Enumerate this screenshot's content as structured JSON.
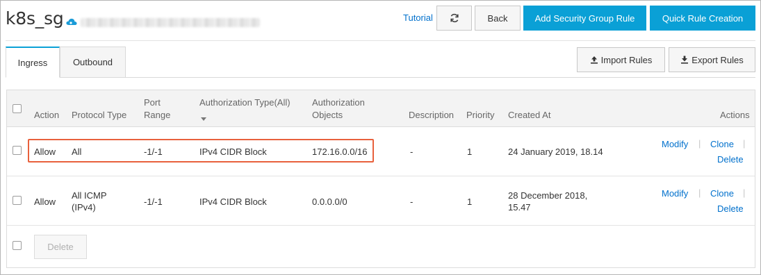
{
  "header": {
    "title": "k8s_sg",
    "tutorial_label": "Tutorial",
    "back_label": "Back",
    "add_rule_label": "Add Security Group Rule",
    "quick_rule_label": "Quick Rule Creation"
  },
  "tabs": [
    {
      "label": "Ingress",
      "active": true
    },
    {
      "label": "Outbound",
      "active": false
    }
  ],
  "toolbar": {
    "import_label": "Import Rules",
    "export_label": "Export Rules"
  },
  "table": {
    "columns": {
      "action": "Action",
      "protocol": "Protocol Type",
      "port_1": "Port",
      "port_2": "Range",
      "auth_type": "Authorization Type(All)",
      "auth_obj_1": "Authorization",
      "auth_obj_2": "Objects",
      "description": "Description",
      "priority": "Priority",
      "created": "Created At",
      "actions": "Actions"
    },
    "rows": [
      {
        "action": "Allow",
        "protocol_1": "All",
        "protocol_2": "",
        "port": "-1/-1",
        "auth_type": "IPv4 CIDR Block",
        "auth_obj": "172.16.0.0/16",
        "description": "-",
        "priority": "1",
        "created_1": "24 January 2019, 18.14",
        "created_2": "",
        "modify": "Modify",
        "clone": "Clone",
        "delete": "Delete"
      },
      {
        "action": "Allow",
        "protocol_1": "All ICMP",
        "protocol_2": "(IPv4)",
        "port": "-1/-1",
        "auth_type": "IPv4 CIDR Block",
        "auth_obj": "0.0.0.0/0",
        "description": "-",
        "priority": "1",
        "created_1": "28 December 2018,",
        "created_2": "15.47",
        "modify": "Modify",
        "clone": "Clone",
        "delete": "Delete"
      }
    ],
    "footer_delete_label": "Delete"
  },
  "colors": {
    "primary": "#0aa0d6",
    "link": "#0070cc",
    "highlight": "#e8603c"
  }
}
